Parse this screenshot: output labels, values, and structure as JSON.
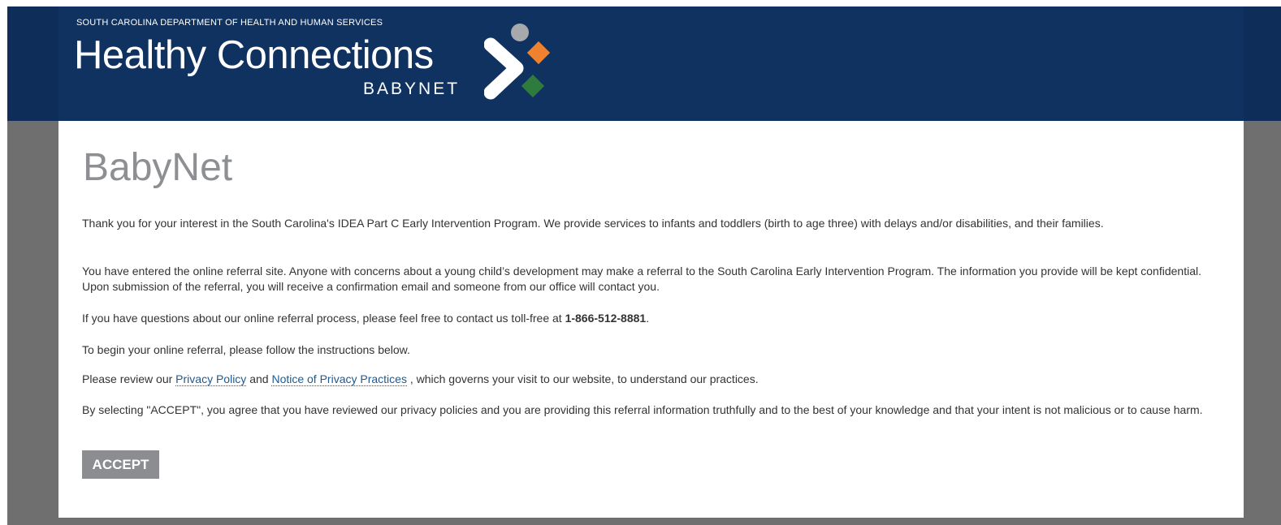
{
  "header": {
    "agency": "South Carolina Department of Health and Human Services",
    "brand": "Healthy Connections",
    "sub_brand": "BABYNET",
    "logo_colors": {
      "top": "#a7a9ac",
      "right": "#f0812f",
      "bottom": "#2f7a3d",
      "chevron": "#ffffff"
    }
  },
  "main": {
    "title": "BabyNet",
    "p1": "Thank you for your interest in the South Carolina's IDEA Part C Early Intervention Program. We provide services to infants and toddlers (birth to age three) with delays and/or disabilities, and their families.",
    "p2": "You have entered the online referral site. Anyone with concerns about a young child’s development may make a referral to the South Carolina Early Intervention Program. The information you provide will be kept confidential. Upon submission of the referral, you will receive a confirmation email and someone from our office will contact you.",
    "p3_prefix": "If you have questions about our online referral process, please feel free to contact us toll-free at ",
    "p3_phone": "1-866-512-8881",
    "p3_suffix": ".",
    "p4": "To begin your online referral, please follow the instructions below.",
    "p5_prefix": "Please review our ",
    "p5_link1": "Privacy Policy",
    "p5_and": " and ",
    "p5_link2": "Notice of Privacy Practices",
    "p5_suffix": " , which governs your visit to our website, to understand our practices.",
    "p6": "By selecting \"ACCEPT\", you agree that you have reviewed our privacy policies and you are providing this referral information truthfully and to the best of your knowledge and that your intent is not malicious or to cause harm.",
    "accept_label": "ACCEPT"
  }
}
